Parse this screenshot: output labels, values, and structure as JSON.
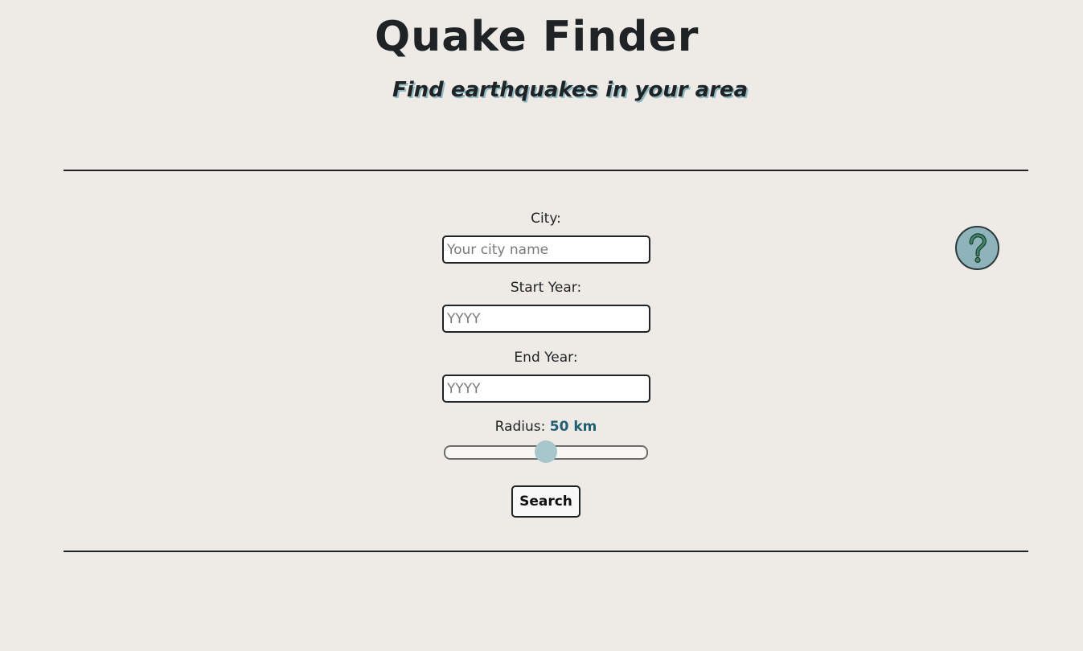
{
  "header": {
    "title": "Quake Finder",
    "subtitle": "Find earthquakes in your area"
  },
  "form": {
    "city": {
      "label": "City:",
      "placeholder": "Your city name",
      "value": ""
    },
    "start_year": {
      "label": "Start Year:",
      "placeholder": "YYYY",
      "value": ""
    },
    "end_year": {
      "label": "End Year:",
      "placeholder": "YYYY",
      "value": ""
    },
    "radius": {
      "label": "Radius:",
      "value_text": "50 km",
      "slider_fraction": 0.5
    },
    "search_label": "Search"
  },
  "help": {
    "icon": "question-mark-icon"
  },
  "colors": {
    "background": "#eeebe6",
    "accent": "#215f73",
    "slider_thumb": "#a7c6cb",
    "help_button": "#8fb3ba",
    "help_glyph": "#3d8a6a",
    "subtitle_shadow": "#8fb8c0"
  }
}
